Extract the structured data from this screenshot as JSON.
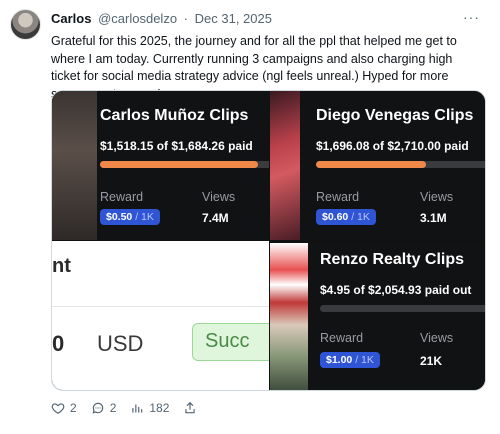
{
  "post": {
    "author_name": "Carlos",
    "handle": "@carlosdelzo",
    "separator": "·",
    "date": "Dec 31, 2025",
    "more_icon": "more-icon",
    "text": "Grateful for this 2025, the journey and for all the ppl that helped me get to where I am today. Currently running 3 campaigns and also charging high ticket for social media strategy advice (ngl feels unreal.) Hyped for more successes to come!"
  },
  "media": {
    "campaigns": [
      {
        "title": "Carlos Muñoz Clips",
        "paid": "$1,518.15 of $1,684.26 paid",
        "progress": 0.9,
        "reward_label": "Reward",
        "reward_value": "$0.50",
        "reward_unit": "/ 1K",
        "views_label": "Views",
        "views_value": "7.4M"
      },
      {
        "title": "Diego Venegas Clips",
        "paid": "$1,696.08 of $2,710.00 paid",
        "progress": 0.63,
        "reward_label": "Reward",
        "reward_value": "$0.60",
        "reward_unit": "/ 1K",
        "views_label": "Views",
        "views_value": "3.1M"
      },
      {
        "title": "Renzo Realty Clips",
        "paid": "$4.95 of $2,054.93 paid out",
        "progress": 0.002,
        "reward_label": "Reward",
        "reward_value": "$1.00",
        "reward_unit": "/ 1K",
        "views_label": "Views",
        "views_value": "21K"
      }
    ],
    "payout_panel": {
      "heading_fragment": "nt",
      "amount_fragment": "0",
      "currency": "USD",
      "status_fragment": "Succ"
    },
    "colors": {
      "progress_fill": "#f0884a",
      "pill": "#2f55d4",
      "card_bg": "#111214"
    }
  },
  "actions": {
    "replies": "2",
    "reposts": "2",
    "views": "182",
    "icons": [
      "heart-icon",
      "reply-icon",
      "views-icon",
      "share-icon"
    ]
  }
}
